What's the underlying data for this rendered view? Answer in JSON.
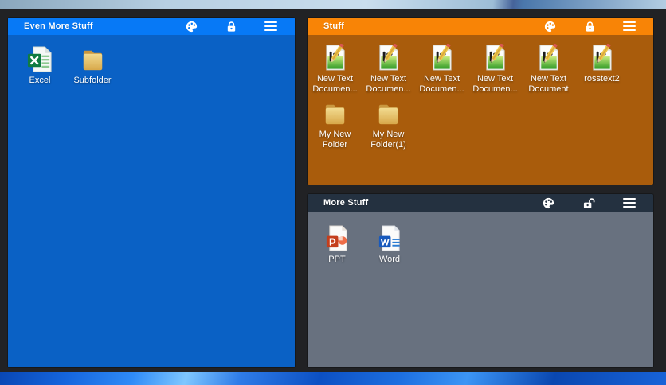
{
  "desktop": {
    "background_color": "#212225",
    "wallpaper_top_color": "#b7cfe2",
    "wallpaper_bottom_color": "#1d6fe0"
  },
  "fences": [
    {
      "title": "Even More Stuff",
      "titlebar_color": "#0779f6",
      "body_color": "#0a61c5",
      "locked": true,
      "controls": [
        "palette-icon",
        "lock-icon",
        "menu-icon"
      ],
      "items": [
        {
          "label": "Excel",
          "icon": "excel-file-icon"
        },
        {
          "label": "Subfolder",
          "icon": "folder-icon"
        }
      ]
    },
    {
      "title": "Stuff",
      "titlebar_color": "#f88406",
      "body_color": "#a95c0c",
      "locked": true,
      "controls": [
        "palette-icon",
        "lock-icon",
        "menu-icon"
      ],
      "items": [
        {
          "label": "New Text Documen...",
          "icon": "text-document-icon"
        },
        {
          "label": "New Text Documen...",
          "icon": "text-document-icon"
        },
        {
          "label": "New Text Documen...",
          "icon": "text-document-icon"
        },
        {
          "label": "New Text Documen...",
          "icon": "text-document-icon"
        },
        {
          "label": "New Text Document",
          "icon": "text-document-icon"
        },
        {
          "label": "rosstext2",
          "icon": "text-document-icon"
        },
        {
          "label": "My New Folder",
          "icon": "folder-icon"
        },
        {
          "label": "My New Folder(1)",
          "icon": "folder-icon"
        }
      ]
    },
    {
      "title": "More Stuff",
      "titlebar_color": "#243140",
      "body_color": "#68717f",
      "locked": false,
      "controls": [
        "palette-icon",
        "unlock-icon",
        "menu-icon"
      ],
      "items": [
        {
          "label": "PPT",
          "icon": "ppt-file-icon"
        },
        {
          "label": "Word",
          "icon": "word-file-icon"
        }
      ]
    }
  ]
}
